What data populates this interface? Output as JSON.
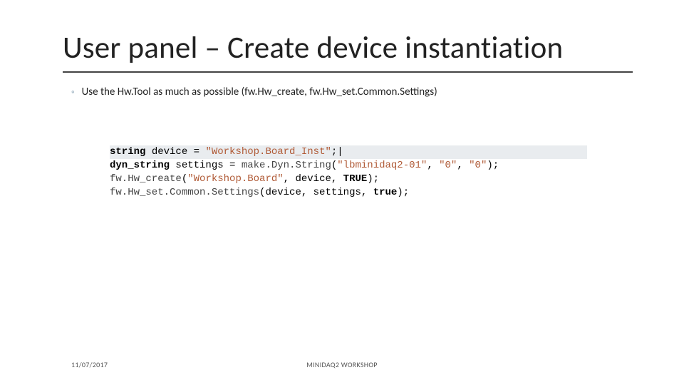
{
  "title": "User panel – Create device instantiation",
  "bullet": {
    "marker": "◦",
    "text": "Use the Hw.Tool as much as possible (fw.Hw_create, fw.Hw_set.Common.Settings)"
  },
  "code": {
    "line1": {
      "t0": "string",
      "t1": " device = ",
      "t2": "\"Workshop.Board_Inst\"",
      "t3": ";|"
    },
    "line2": {
      "t0": "dyn_string",
      "t1": " settings = ",
      "t2": "make.Dyn.String",
      "t3": "(",
      "t4": "\"lbminidaq2-01\"",
      "t5": ", ",
      "t6": "\"0\"",
      "t7": ", ",
      "t8": "\"0\"",
      "t9": ");"
    },
    "line3": {
      "t0": "fw.Hw_create",
      "t1": "(",
      "t2": "\"Workshop.Board\"",
      "t3": ", device, ",
      "t4": "TRUE",
      "t5": ");"
    },
    "line4": {
      "t0": "fw.Hw_set.Common.Settings",
      "t1": "(device, settings, ",
      "t2": "true",
      "t3": ");"
    }
  },
  "footer": {
    "date": "11/07/2017",
    "center": "MINIDAQ2 WORKSHOP"
  }
}
